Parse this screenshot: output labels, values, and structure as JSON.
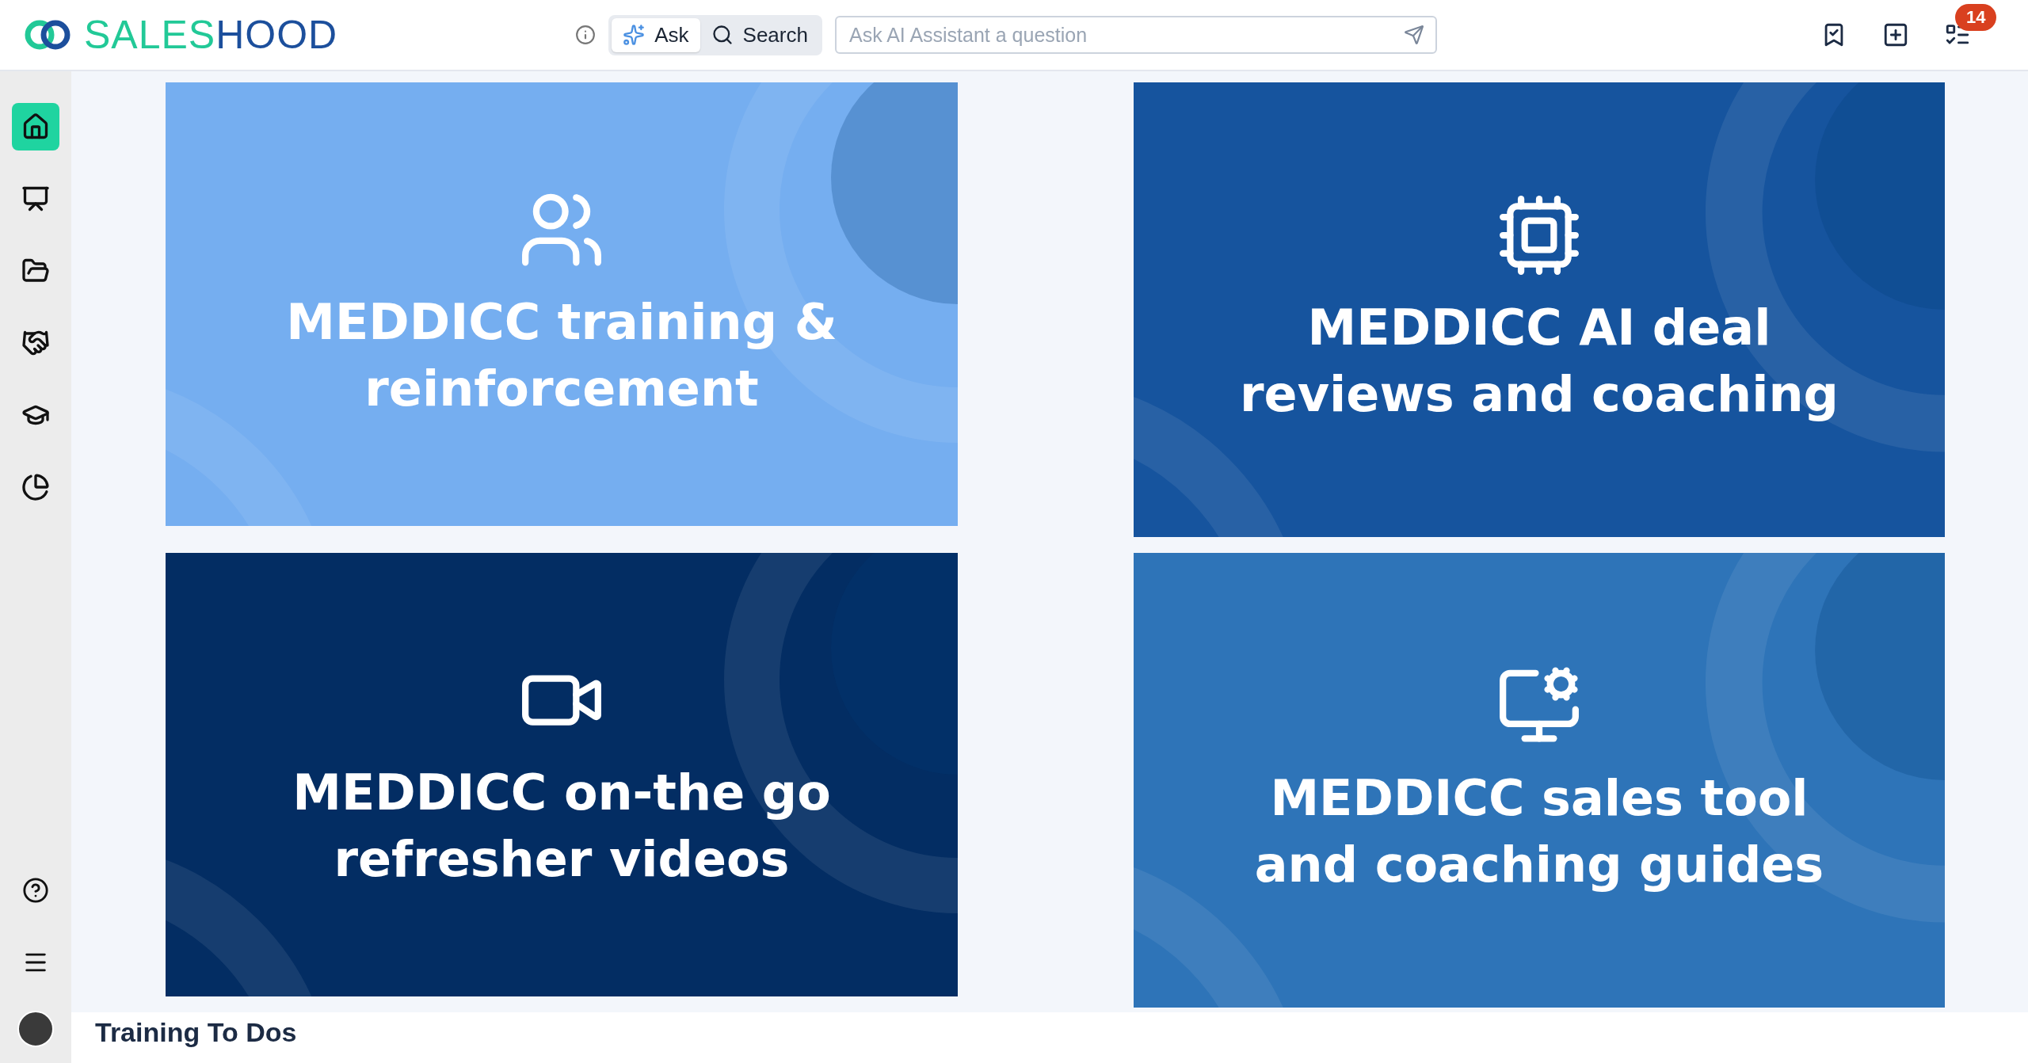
{
  "header": {
    "logo": [
      "SALES",
      "HOOD"
    ],
    "mode_tabs": [
      {
        "label": "Ask",
        "kind": "ask",
        "selected": true
      },
      {
        "label": "Search",
        "kind": "search",
        "selected": false
      }
    ],
    "ask_field": {
      "placeholder": "Ask AI Assistant a question"
    },
    "notification_count": "14"
  },
  "sidebar": {
    "items": [
      {
        "kind": "home",
        "selected": true
      },
      {
        "kind": "presenter",
        "selected": false
      },
      {
        "kind": "folder",
        "selected": false
      },
      {
        "kind": "handshake",
        "selected": false
      },
      {
        "kind": "graduation",
        "selected": false
      },
      {
        "kind": "chart",
        "selected": false
      }
    ],
    "bottom_items": [
      {
        "kind": "help"
      },
      {
        "kind": "menu"
      },
      {
        "kind": "avatar"
      }
    ]
  },
  "cards": [
    {
      "title": "MEDDICC training & reinforcement",
      "kind": "training",
      "color": "#75aef0"
    },
    {
      "title": "MEDDICC AI deal reviews and coaching",
      "kind": "ai",
      "color": "#16549e"
    },
    {
      "title": "MEDDICC on-the go refresher videos",
      "kind": "video",
      "color": "#032d63"
    },
    {
      "title": "MEDDICC sales tool and coaching guides",
      "kind": "tools",
      "color": "#2e74b8"
    }
  ],
  "section": {
    "title": "Training To Dos"
  }
}
